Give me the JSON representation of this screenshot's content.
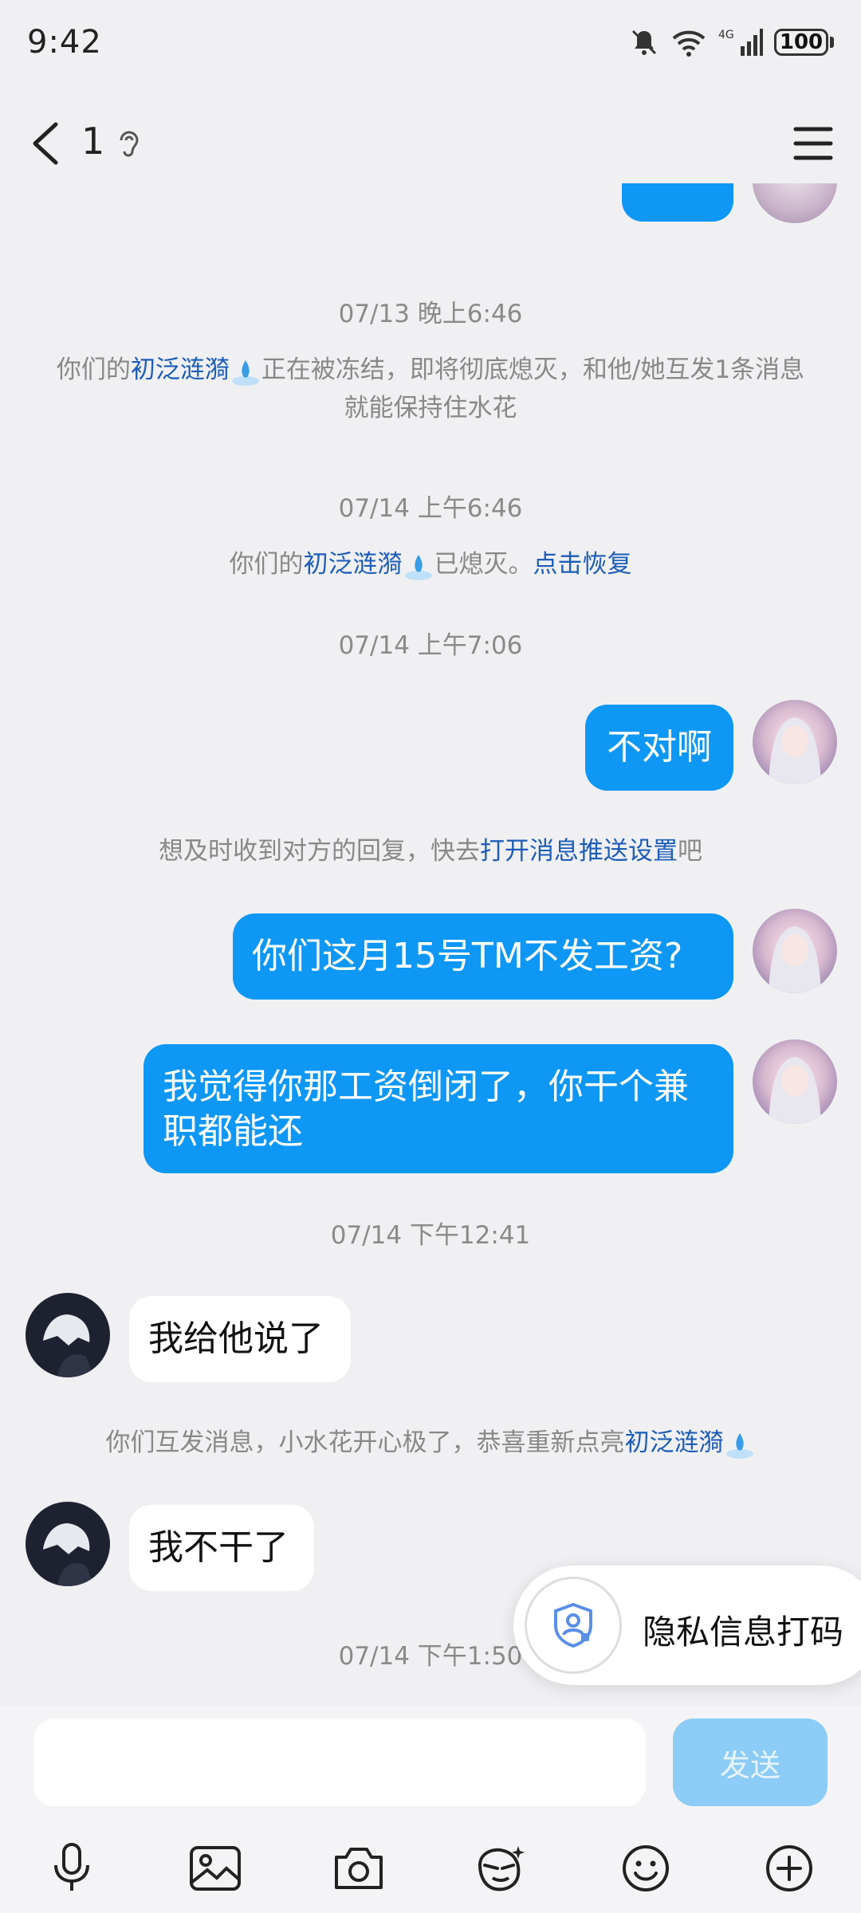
{
  "status": {
    "time": "9:42",
    "network": "4G",
    "wifi_label": "6",
    "battery": "100"
  },
  "nav": {
    "title": "1"
  },
  "messages": {
    "ts1": "07/13 晚上6:46",
    "sys1_pre": "你们的",
    "sys1_hl": "初泛涟漪",
    "sys1_post": "正在被冻结，即将彻底熄灭，和他/她互发1条消息就能保持住水花",
    "ts2": "07/14 上午6:46",
    "sys2_pre": "你们的",
    "sys2_hl": "初泛涟漪",
    "sys2_mid": "已熄灭。",
    "sys2_link": "点击恢复",
    "ts3": "07/14 上午7:06",
    "m1": "不对啊",
    "sys3_pre": "想及时收到对方的回复，快去",
    "sys3_link": "打开消息推送设置",
    "sys3_post": "吧",
    "m2": "你们这月15号TM不发工资?",
    "m3": "我觉得你那工资倒闭了，你干个兼职都能还",
    "ts4": "07/14 下午12:41",
    "m4": "我给他说了",
    "sys4_pre": "你们互发消息，小水花开心极了，恭喜重新点亮",
    "sys4_hl": "初泛涟漪",
    "m5": "我不干了",
    "ts5": "07/14 下午1:50"
  },
  "privacy": {
    "label": "隐私信息打码"
  },
  "input": {
    "send_label": "发送"
  },
  "colors": {
    "accent": "#0e97f5",
    "link": "#1d5db8",
    "background": "#f0f0f3"
  }
}
